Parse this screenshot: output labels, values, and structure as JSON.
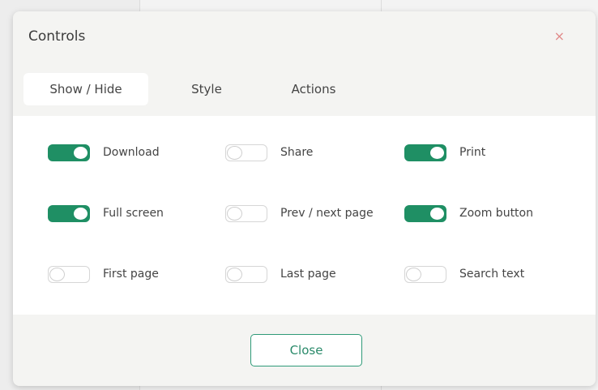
{
  "dialog": {
    "title": "Controls",
    "close_icon": "×"
  },
  "tabs": [
    {
      "label": "Show / Hide",
      "active": true
    },
    {
      "label": "Style",
      "active": false
    },
    {
      "label": "Actions",
      "active": false
    }
  ],
  "options": [
    {
      "label": "Download",
      "enabled": true
    },
    {
      "label": "Share",
      "enabled": false
    },
    {
      "label": "Print",
      "enabled": true
    },
    {
      "label": "Full screen",
      "enabled": true
    },
    {
      "label": "Prev / next page",
      "enabled": false
    },
    {
      "label": "Zoom button",
      "enabled": true
    },
    {
      "label": "First page",
      "enabled": false
    },
    {
      "label": "Last page",
      "enabled": false
    },
    {
      "label": "Search text",
      "enabled": false
    }
  ],
  "footer": {
    "close_label": "Close"
  },
  "colors": {
    "accent": "#1f8f64",
    "close_icon": "#e08a8a"
  }
}
